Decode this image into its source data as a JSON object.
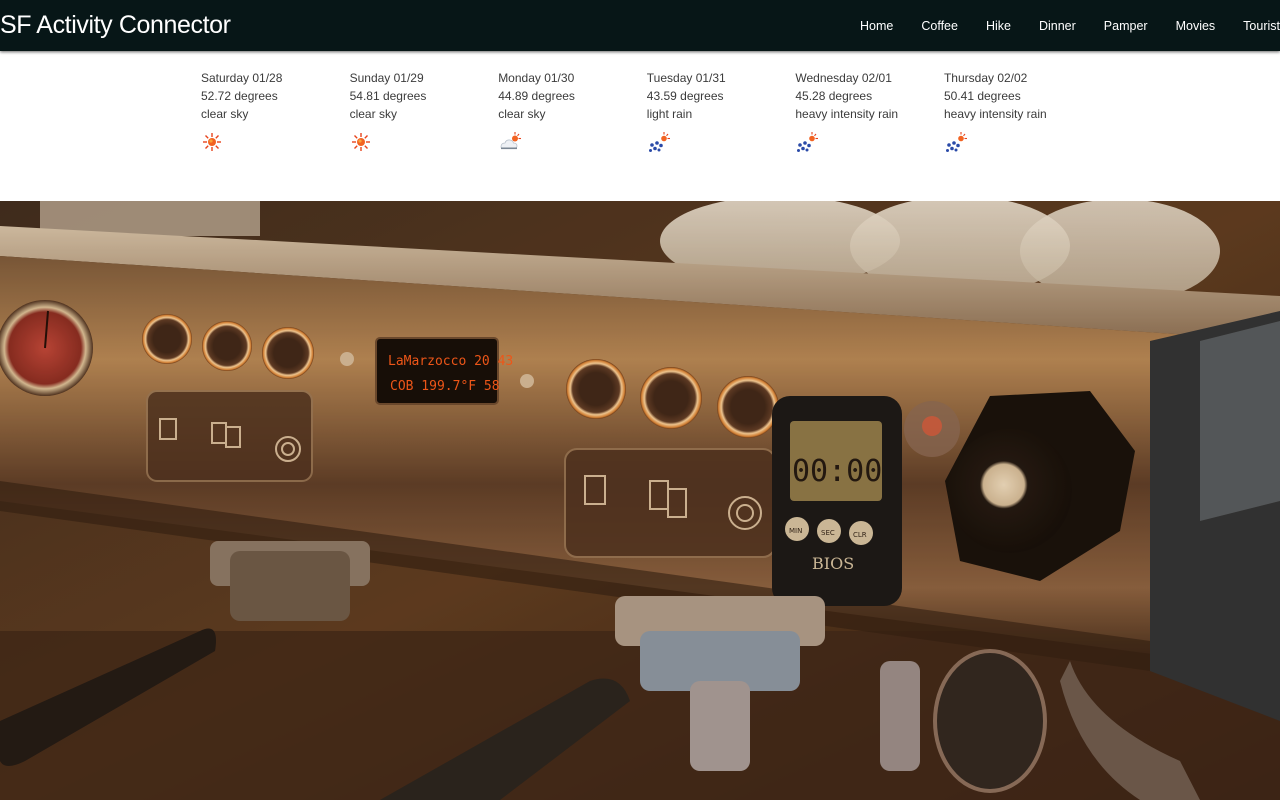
{
  "navbar": {
    "brand": "SF Activity Connector",
    "links": [
      "Home",
      "Coffee",
      "Hike",
      "Dinner",
      "Pamper",
      "Movies",
      "Tourist"
    ]
  },
  "forecast": [
    {
      "date": "Saturday 01/28",
      "temp": "52.72 degrees",
      "desc": "clear sky",
      "icon": "sun-icon"
    },
    {
      "date": "Sunday 01/29",
      "temp": "54.81 degrees",
      "desc": "clear sky",
      "icon": "sun-icon"
    },
    {
      "date": "Monday 01/30",
      "temp": "44.89 degrees",
      "desc": "clear sky",
      "icon": "cloud-sun-icon"
    },
    {
      "date": "Tuesday 01/31",
      "temp": "43.59 degrees",
      "desc": "light rain",
      "icon": "rain-sun-icon"
    },
    {
      "date": "Wednesday 02/01",
      "temp": "45.28 degrees",
      "desc": "heavy intensity rain",
      "icon": "rain-sun-icon"
    },
    {
      "date": "Thursday 02/02",
      "temp": "50.41 degrees",
      "desc": "heavy intensity rain",
      "icon": "rain-sun-icon"
    }
  ],
  "hero": {
    "image": "espresso-machine-photo",
    "display_text_line1": "LaMarzocco 20 43",
    "display_text_line2": "COB 199.7°F 58",
    "timer_text": "00:00",
    "timer_buttons": [
      "MIN",
      "SEC",
      "CLR"
    ],
    "timer_brand": "BIOS"
  },
  "colors": {
    "navbar_bg": "#071617",
    "nav_text": "#ffffff",
    "forecast_text": "#3b3b3b",
    "sun": "#e8431c",
    "rain": "#2a4aa8"
  }
}
